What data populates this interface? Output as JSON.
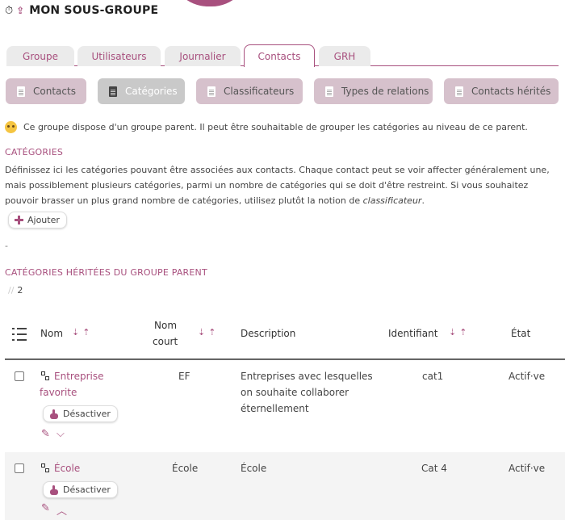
{
  "header": {
    "clock_icon": "stopwatch-icon",
    "up_icon": "arrow-up-icon",
    "title": "MON SOUS-GROUPE"
  },
  "tabs": [
    {
      "label": "Groupe",
      "active": false
    },
    {
      "label": "Utilisateurs",
      "active": false
    },
    {
      "label": "Journalier",
      "active": false
    },
    {
      "label": "Contacts",
      "active": true
    },
    {
      "label": "GRH",
      "active": false
    }
  ],
  "subtabs": [
    {
      "label": "Contacts",
      "active": false
    },
    {
      "label": "Catégories",
      "active": true
    },
    {
      "label": "Classificateurs",
      "active": false
    },
    {
      "label": "Types de relations",
      "active": false
    },
    {
      "label": "Contacts hérités",
      "active": false
    }
  ],
  "notice": "Ce groupe dispose d'un groupe parent. Il peut être souhaitable de grouper les catégories au niveau de ce parent.",
  "categories": {
    "title": "CATÉGORIES",
    "description_part1": "Définissez ici les catégories pouvant être associées aux contacts. Chaque contact peut se voir affecter généralement une, mais possiblement plusieurs catégories, parmi un nombre de catégories qui se doit d'être restreint. Si vous souhaitez pouvoir brasser un plus grand nombre de catégories, utilisez plutôt la notion de ",
    "description_em": "classificateur",
    "description_end": ".",
    "add_label": "Ajouter",
    "empty_marker": "-"
  },
  "inherited": {
    "title": "CATÉGORIES HÉRITÉES DU GROUPE PARENT",
    "count_prefix": "//",
    "count": "2"
  },
  "table": {
    "columns": {
      "nom": "Nom",
      "nom_court_1": "Nom",
      "nom_court_2": "court",
      "description": "Description",
      "identifiant": "Identifiant",
      "etat": "État"
    },
    "rows": [
      {
        "name_line1": "Entreprise",
        "name_line2": "favorite",
        "short": "EF",
        "description_line1": "Entreprises avec lesquelles",
        "description_line2": "on souhaite collaborer",
        "description_line3": "éternellement",
        "id": "cat1",
        "state": "Actif·ve",
        "action": "Désactiver"
      },
      {
        "name_line1": "École",
        "short": "École",
        "description_line1": "École",
        "id": "Cat 4",
        "state": "Actif·ve",
        "action": "Désactiver"
      }
    ]
  },
  "colors": {
    "accent": "#a8507e",
    "subtab_bg": "#d6c1cc",
    "subtab_active_bg": "#c9c9c9"
  }
}
